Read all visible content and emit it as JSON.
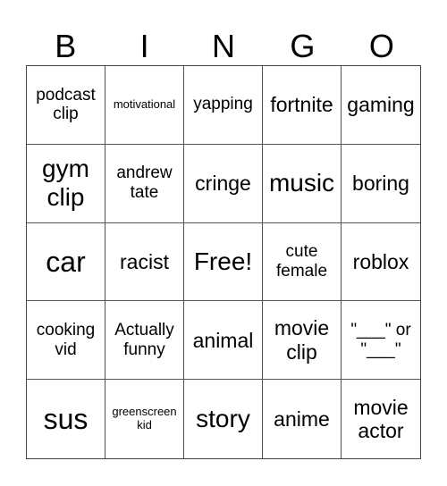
{
  "header": [
    "B",
    "I",
    "N",
    "G",
    "O"
  ],
  "cells": [
    {
      "text": "podcast clip",
      "size": "s-sm"
    },
    {
      "text": "motivational",
      "size": "s-xs"
    },
    {
      "text": "yapping",
      "size": "s-sm"
    },
    {
      "text": "fortnite",
      "size": "s-md"
    },
    {
      "text": "gaming",
      "size": "s-md"
    },
    {
      "text": "gym clip",
      "size": "s-lg"
    },
    {
      "text": "andrew tate",
      "size": "s-sm"
    },
    {
      "text": "cringe",
      "size": "s-md"
    },
    {
      "text": "music",
      "size": "s-lg"
    },
    {
      "text": "boring",
      "size": "s-md"
    },
    {
      "text": "car",
      "size": "s-xl"
    },
    {
      "text": "racist",
      "size": "s-md"
    },
    {
      "text": "Free!",
      "size": "s-lg"
    },
    {
      "text": "cute female",
      "size": "s-sm"
    },
    {
      "text": "roblox",
      "size": "s-md"
    },
    {
      "text": "cooking vid",
      "size": "s-sm"
    },
    {
      "text": "Actually funny",
      "size": "s-sm"
    },
    {
      "text": "animal",
      "size": "s-md"
    },
    {
      "text": "movie clip",
      "size": "s-md"
    },
    {
      "text": "\"___\" or \"___\"",
      "size": "s-sm"
    },
    {
      "text": "sus",
      "size": "s-xl"
    },
    {
      "text": "greenscreen kid",
      "size": "s-xs"
    },
    {
      "text": "story",
      "size": "s-lg"
    },
    {
      "text": "anime",
      "size": "s-md"
    },
    {
      "text": "movie actor",
      "size": "s-md"
    }
  ]
}
